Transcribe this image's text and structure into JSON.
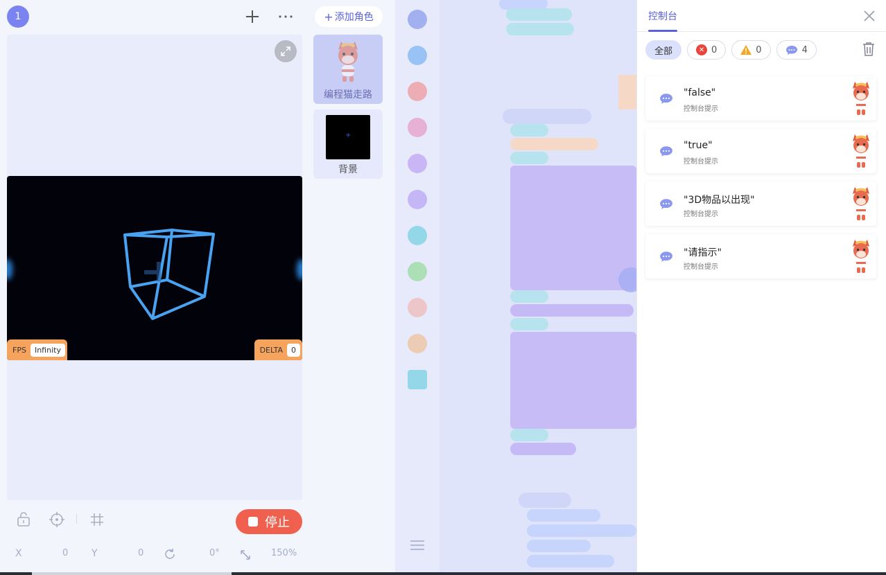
{
  "stage": {
    "badge": "1",
    "fps_label": "FPS",
    "fps_value": "Infinity",
    "delta_label": "DELTA",
    "delta_value": "0",
    "stop_label": "停止",
    "coords": {
      "x_label": "X",
      "x_value": "0",
      "y_label": "Y",
      "y_value": "0",
      "rotation": "0°",
      "scale": "150%"
    }
  },
  "sprites": {
    "add_label": "添加角色",
    "items": [
      {
        "name": "编程猫走路"
      },
      {
        "name": "背景"
      }
    ]
  },
  "console": {
    "tab_label": "控制台",
    "filters": {
      "all_label": "全部",
      "error_count": "0",
      "warning_count": "0",
      "message_count": "4"
    },
    "messages": [
      {
        "text": "\"false\"",
        "sub": "控制台提示"
      },
      {
        "text": "\"true\"",
        "sub": "控制台提示"
      },
      {
        "text": "\"3D物品以出现\"",
        "sub": "控制台提示"
      },
      {
        "text": "\"请指示\"",
        "sub": "控制台提示"
      }
    ]
  },
  "colors": {
    "accent": "#5a62d8",
    "stop": "#f0604f",
    "stat_chip": "#f6a35e",
    "cube_stroke": "#4aa3f0"
  }
}
